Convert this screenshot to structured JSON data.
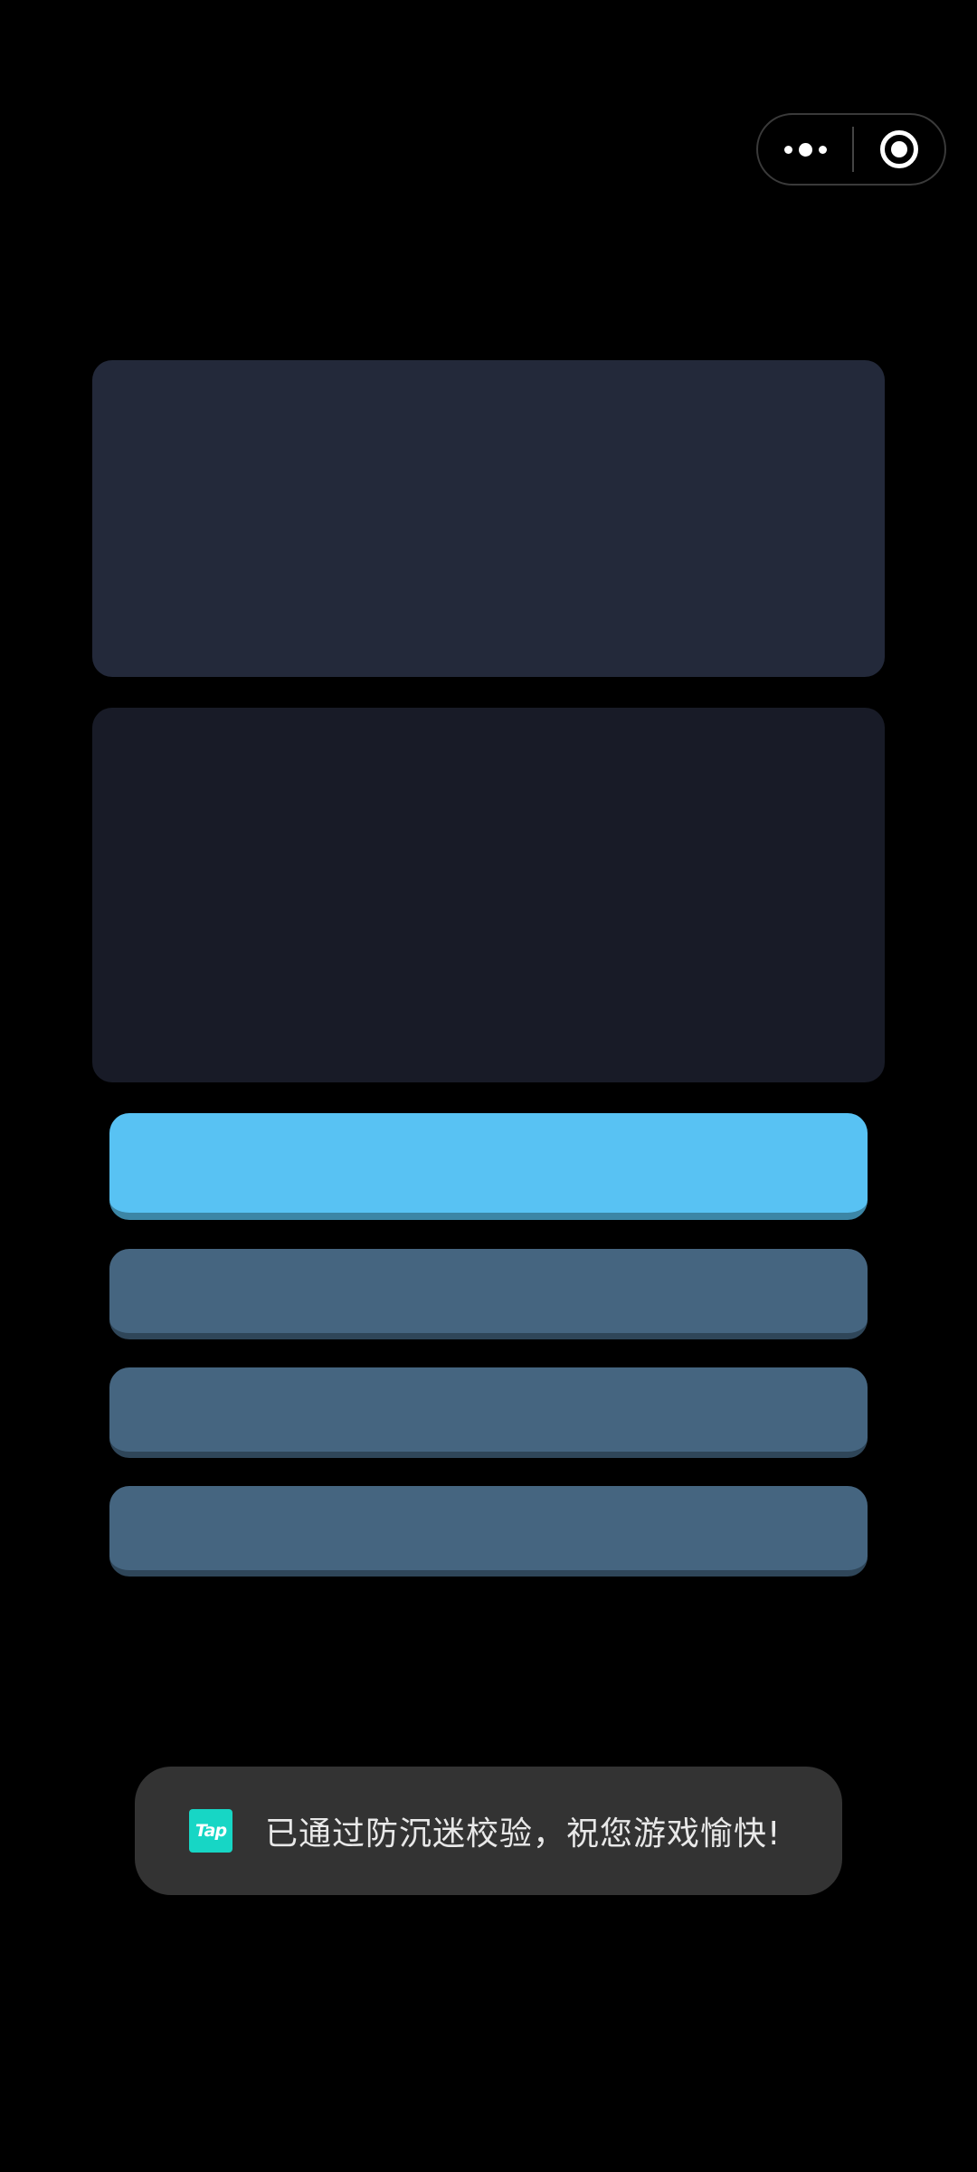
{
  "capsule": {
    "more_icon": "more-dots-icon",
    "close_icon": "target-circle-icon"
  },
  "colors": {
    "background": "#000000",
    "panel_top": "#23293a",
    "panel_bottom": "#181b27",
    "button_primary": "#58c2f3",
    "button_secondary": "#456580",
    "toast_background": "#333333",
    "tap_brand": "#17d6c5"
  },
  "toast": {
    "logo_text": "Tap",
    "message": "已通过防沉迷校验，祝您游戏愉快!"
  }
}
